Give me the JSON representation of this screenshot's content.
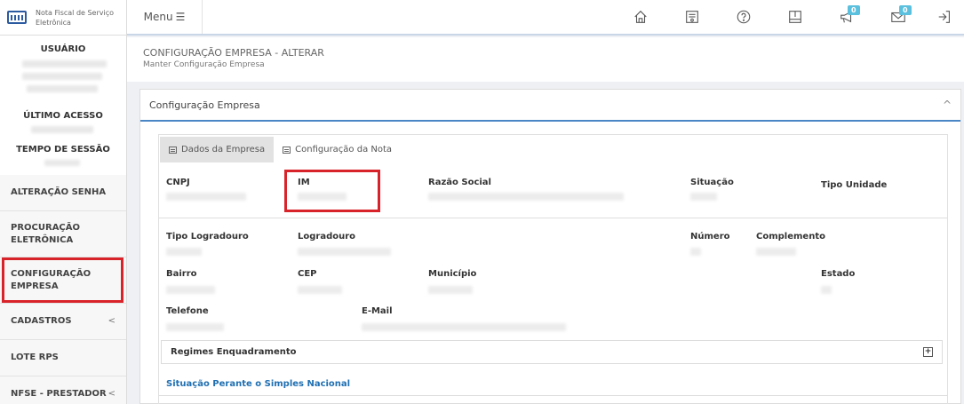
{
  "sidebar": {
    "logo_text": "Nota Fiscal de Serviço Eletrônica",
    "usuario_heading": "USUÁRIO",
    "ultimo_acesso_heading": "ÚLTIMO ACESSO",
    "tempo_sessao_heading": "TEMPO DE SESSÃO",
    "items": [
      {
        "label": "ALTERAÇÃO SENHA"
      },
      {
        "label": "PROCURAÇÃO ELETRÔNICA"
      },
      {
        "label": "CONFIGURAÇÃO EMPRESA"
      },
      {
        "label": "CADASTROS"
      },
      {
        "label": "LOTE RPS"
      },
      {
        "label": "NFSE - PRESTADOR"
      }
    ]
  },
  "topbar": {
    "menu_label": "Menu",
    "menu_icon": "☰",
    "icons": [
      "home-icon",
      "certificate-icon",
      "help-icon",
      "book-icon",
      "megaphone-icon",
      "mail-icon",
      "logout-icon"
    ],
    "badge_announcements": "0",
    "badge_mail": "0"
  },
  "header": {
    "title": "CONFIGURAÇÃO EMPRESA - ALTERAR",
    "subtitle": "Manter Configuração Empresa"
  },
  "panel": {
    "title": "Configuração Empresa",
    "collapse_icon": "^",
    "tabs": [
      {
        "label": "Dados da Empresa"
      },
      {
        "label": "Configuração da Nota"
      }
    ],
    "fields": {
      "cnpj": "CNPJ",
      "im": "IM",
      "razao_social": "Razão Social",
      "situacao": "Situação",
      "tipo_unidade": "Tipo Unidade",
      "tipo_logradouro": "Tipo Logradouro",
      "logradouro": "Logradouro",
      "numero": "Número",
      "complemento": "Complemento",
      "bairro": "Bairro",
      "cep": "CEP",
      "municipio": "Município",
      "estado": "Estado",
      "telefone": "Telefone",
      "email": "E-Mail"
    },
    "regimes_label": "Regimes Enquadramento",
    "regimes_plus": "+",
    "simples_link": "Situação Perante o Simples Nacional"
  },
  "colors": {
    "accent": "#4a86c5",
    "highlight": "#d9232a",
    "link": "#1f6fb2",
    "badge": "#5bc0de"
  }
}
